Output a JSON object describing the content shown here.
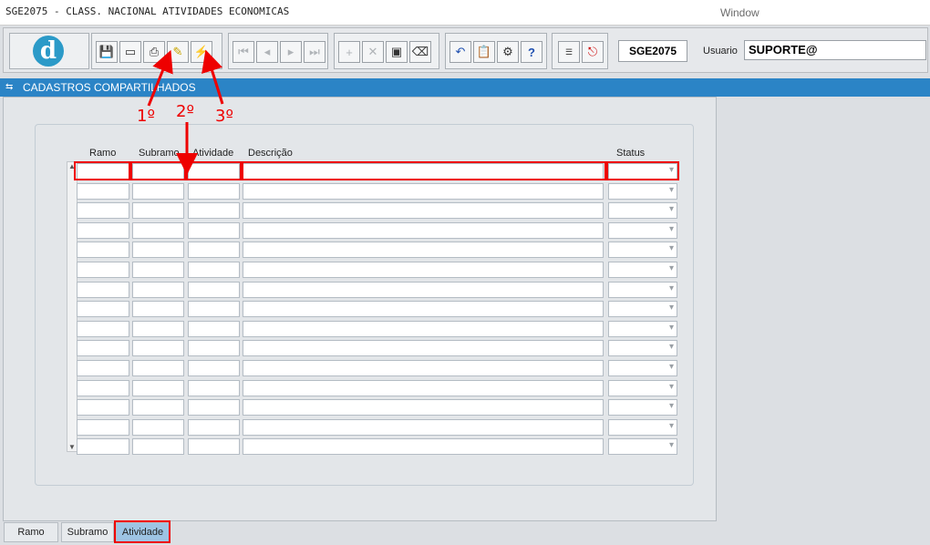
{
  "window": {
    "title": "SGE2075 - CLASS. NACIONAL ATIVIDADES ECONOMICAS",
    "menu_window": "Window"
  },
  "toolbar": {
    "logo_letter": "d",
    "form_code": "SGE2075",
    "user_label": "Usuario",
    "user_value": "SUPORTE@"
  },
  "section": {
    "title": "CADASTROS COMPARTILHADOS"
  },
  "grid": {
    "columns": [
      "Ramo",
      "Subramo",
      "Atividade",
      "Descrição",
      "Status"
    ],
    "row_count": 15
  },
  "tabs": [
    {
      "label": "Ramo",
      "active": false
    },
    {
      "label": "Subramo",
      "active": false
    },
    {
      "label": "Atividade",
      "active": true
    }
  ],
  "annotations": [
    "1º",
    "2º",
    "3º"
  ],
  "colors": {
    "accent": "#2b84c6",
    "highlight": "#e00000",
    "active_tab": "#9dc4e4"
  }
}
